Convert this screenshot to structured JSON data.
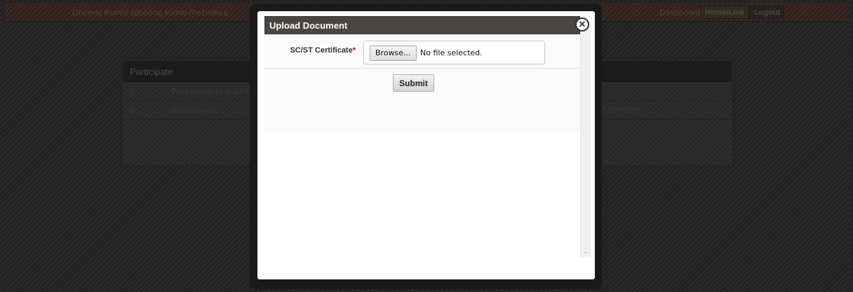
{
  "header": {
    "user_text": "Dheeraj Kumar (dheeraj.kumar@e1ndia.c",
    "dashboard_label": "Dashboard",
    "nav_button_1": "Home/Link",
    "nav_button_2": "Logout"
  },
  "participate": {
    "title": "Participate",
    "rows": [
      {
        "num": "1",
        "label": "Participation & EMD",
        "status": ""
      },
      {
        "num": "2",
        "label": "Documents",
        "status": "Not Uploaded"
      }
    ]
  },
  "modal": {
    "title": "Upload Document",
    "field_label": "SC/ST Certificate",
    "required_mark": "*",
    "browse_label": "Browse...",
    "file_status": "No file selected.",
    "submit_label": "Submit",
    "close_symbol": "✕",
    "scroll_down_symbol": "⌄"
  }
}
